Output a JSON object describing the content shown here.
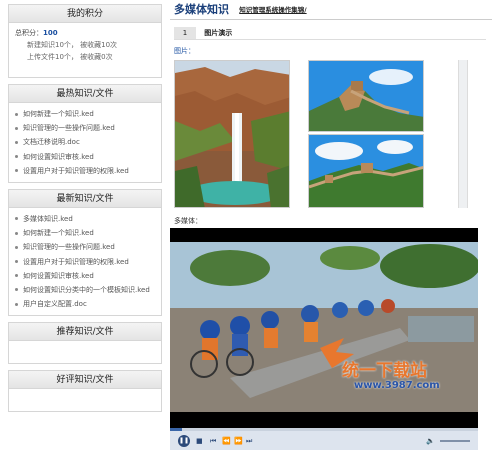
{
  "sidebar": {
    "points": {
      "title": "我的积分",
      "total_label": "总积分：",
      "total_value": "100",
      "line1": "新建知识10个，  被收藏10次",
      "line2": "上传文件10个，  被收藏0次"
    },
    "hot": {
      "title": "最热知识/文件",
      "items": [
        "如何新建一个知识.ked",
        "知识管理的一些操作问题.ked",
        "文档迁移说明.doc",
        "如何设置知识审核.ked",
        "设置用户对于知识管理的权限.ked"
      ]
    },
    "latest": {
      "title": "最新知识/文件",
      "items": [
        "多媒体知识.ked",
        "如何新建一个知识.ked",
        "知识管理的一些操作问题.ked",
        "设置用户对于知识管理的权限.ked",
        "如何设置知识审核.ked",
        "如何设置知识分类中的一个模板知识.ked",
        "用户自定义配置.doc"
      ]
    },
    "recommend": {
      "title": "推荐知识/文件"
    },
    "rated": {
      "title": "好评知识/文件"
    }
  },
  "main": {
    "title": "多媒体知识",
    "subtitle": "知识管理系统操作集锦/",
    "section_num": "1",
    "section_label": "图片演示",
    "pictures_label": "图片：",
    "multimedia_label": "多媒体：",
    "watermark_main": "统一下载站",
    "watermark_url": "www.3987.com"
  },
  "colors": {
    "title": "#1a3f7a",
    "link": "#1a4fa0",
    "watermark": "#e8772e"
  }
}
